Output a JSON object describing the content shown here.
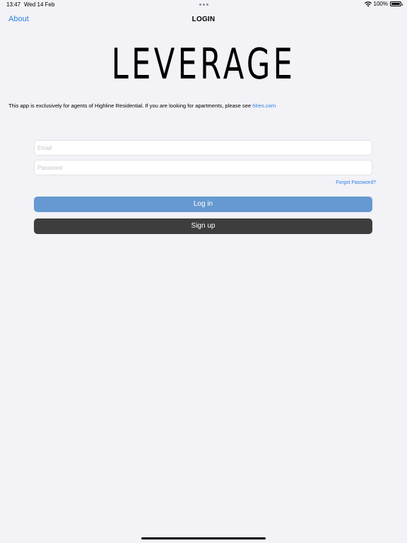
{
  "status_bar": {
    "time": "13:47",
    "date": "Wed 14 Feb",
    "battery_percent": "100%",
    "battery_level": 1.0,
    "icons": [
      "wifi-icon",
      "battery-icon"
    ]
  },
  "nav": {
    "about_label": "About",
    "title": "LOGIN"
  },
  "logo": {
    "text": "LEVERAGE"
  },
  "notice": {
    "text": "This app is exclusively for agents of Highline Residential.  If you are looking for apartments, please see ",
    "link_text": "hlres.com"
  },
  "form": {
    "email": {
      "value": "",
      "placeholder": "Email"
    },
    "password": {
      "value": "",
      "placeholder": "Password"
    },
    "forgot_label": "Forgot Password?",
    "login_label": "Log in",
    "signup_label": "Sign up"
  },
  "colors": {
    "background": "#f2f2f7",
    "link": "#2d7fe3",
    "login_button": "#6699d1",
    "signup_button": "#3d3d3d"
  }
}
